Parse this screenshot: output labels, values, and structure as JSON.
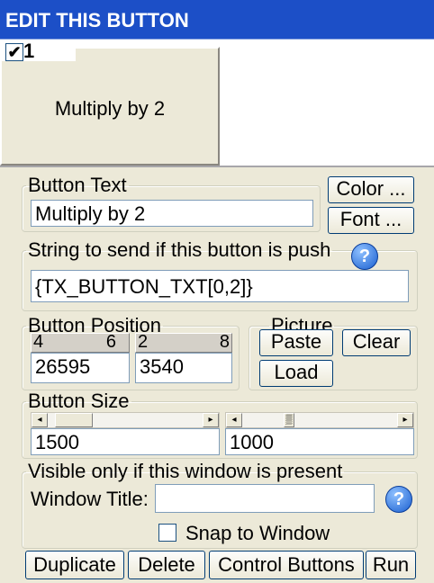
{
  "window": {
    "title": "EDIT THIS BUTTON"
  },
  "preview": {
    "checkbox_checked": true,
    "checkbox_glyph": "✔",
    "index_label": "1",
    "button_text": "Multiply by 2"
  },
  "button_text_group": {
    "legend": "Button Text",
    "value": "Multiply by 2",
    "color_button": "Color ...",
    "font_button": "Font ..."
  },
  "string_group": {
    "legend": "String to send if this button is push",
    "value": "{TX_BUTTON_TXT[0,2]}",
    "help_icon": "?"
  },
  "position_group": {
    "legend": "Button Position",
    "x_tick_left": "4",
    "x_tick_right": "6",
    "y_tick_left": "2",
    "y_tick_right": "8",
    "x_value": "26595",
    "y_value": "3540"
  },
  "picture_group": {
    "legend": "Picture",
    "paste_button": "Paste",
    "clear_button": "Clear",
    "load_button": "Load"
  },
  "size_group": {
    "legend": "Button Size",
    "width_value": "1500",
    "height_value": "1000",
    "arrow_left": "◂",
    "arrow_right": "▸",
    "thumb_grip": "▒"
  },
  "visible_group": {
    "legend": "Visible only if this window is present",
    "window_title_label": "Window Title:",
    "window_title_value": "",
    "help_icon": "?",
    "snap_label": "Snap to Window",
    "snap_checked": false
  },
  "footer": {
    "duplicate_button": "Duplicate",
    "delete_button": "Delete",
    "control_buttons_button": "Control Buttons",
    "run_button": "Run"
  },
  "colors": {
    "titlebar": "#1c4fc7",
    "dialog_bg": "#ece9d8",
    "input_border": "#7f9db9"
  }
}
